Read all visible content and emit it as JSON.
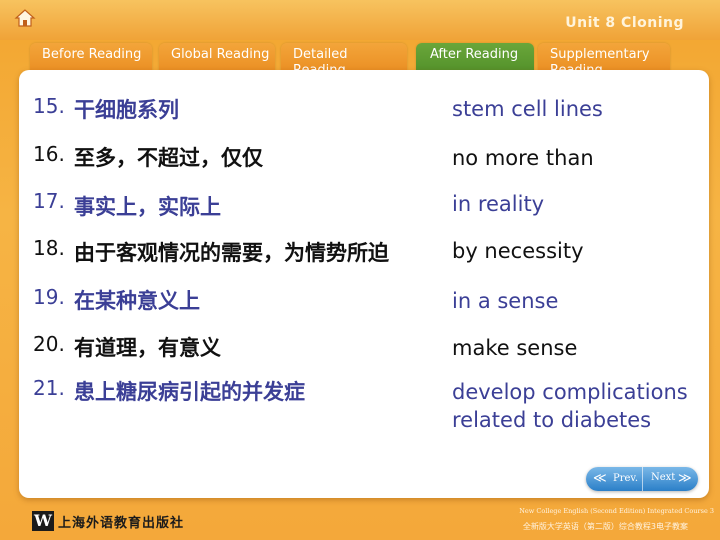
{
  "header": {
    "unit_title": "Unit 8 Cloning"
  },
  "tabs": [
    {
      "label": "Before Reading",
      "active": false
    },
    {
      "label": "Global Reading",
      "active": false
    },
    {
      "label": "Detailed Reading",
      "active": false
    },
    {
      "label": "After Reading",
      "active": true
    },
    {
      "label": "Supplementary Reading",
      "active": false
    }
  ],
  "vocab": [
    {
      "num": "15.",
      "cn": "干细胞系列",
      "en": "stem cell lines",
      "color": "#3b3f96"
    },
    {
      "num": "16.",
      "cn": "至多，不超过，仅仅",
      "en": "no more than",
      "color": "#111111"
    },
    {
      "num": "17.",
      "cn": "事实上，实际上",
      "en": "in reality",
      "color": "#3b3f96"
    },
    {
      "num": "18.",
      "cn": "由于客观情况的需要，为情势所迫",
      "en": "by necessity",
      "color": "#111111"
    },
    {
      "num": "19.",
      "cn": "在某种意义上",
      "en": "in a sense",
      "color": "#3b3f96"
    },
    {
      "num": "20.",
      "cn": "有道理，有意义",
      "en": "make sense",
      "color": "#111111"
    },
    {
      "num": "21.",
      "cn": "患上糖尿病引起的并发症",
      "en_line1": "develop complications",
      "en_line2": "related to diabetes",
      "color": "#3b3f96"
    }
  ],
  "nav": {
    "prev_label": "Prev.",
    "next_label": "Next",
    "prev_arrow": "≪",
    "next_arrow": "≫"
  },
  "footer": {
    "publisher_mark": "W",
    "publisher_name": "上海外语教育出版社",
    "book_en": "New College English (Second Edition) Integrated Course 3",
    "book_cn": "全新版大学英语（第二版）综合教程3电子教案"
  },
  "icons": {
    "home": "home-icon",
    "prev": "double-chevron-left-icon",
    "next": "double-chevron-right-icon"
  },
  "colors": {
    "background_orange": "#f4a83a",
    "active_tab_green": "#4f8e28",
    "text_blue": "#3b3f96",
    "text_black": "#111111",
    "nav_blue": "#2b7fc8"
  }
}
